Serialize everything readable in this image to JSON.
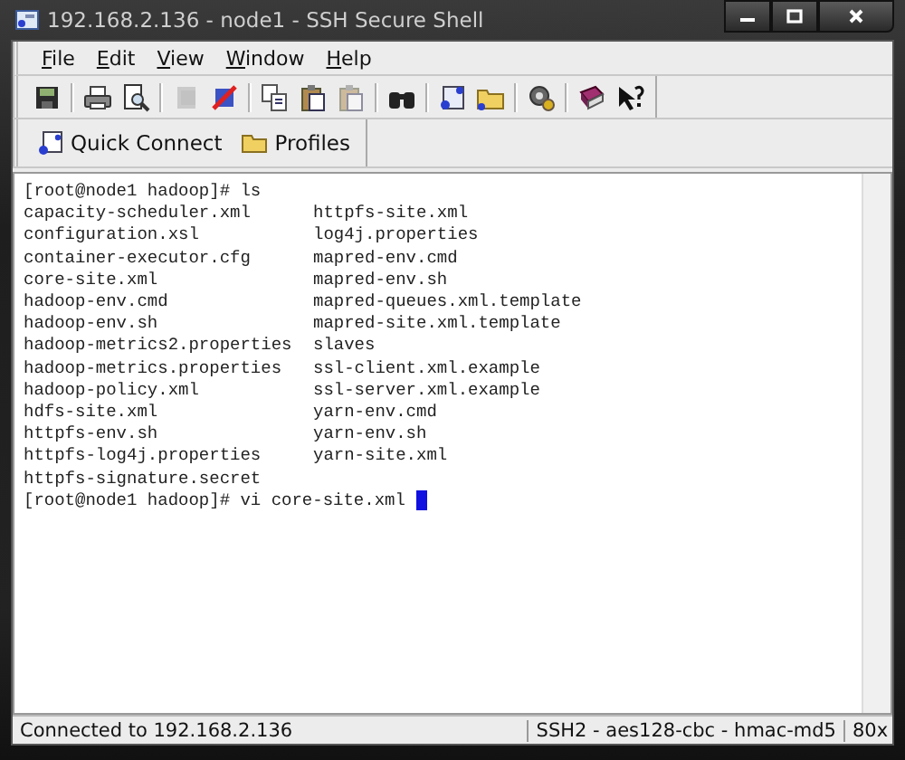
{
  "window": {
    "title": "192.168.2.136 - node1 - SSH Secure Shell"
  },
  "menu": [
    {
      "label": "File"
    },
    {
      "label": "Edit"
    },
    {
      "label": "View"
    },
    {
      "label": "Window"
    },
    {
      "label": "Help"
    }
  ],
  "quickbar": [
    {
      "label": "Quick Connect",
      "kind": "connect"
    },
    {
      "label": "Profiles",
      "kind": "folder"
    }
  ],
  "terminal": {
    "lines": [
      {
        "kind": "text",
        "text": "[root@node1 hadoop]# ls"
      },
      {
        "kind": "columns",
        "cells": [
          "capacity-scheduler.xml",
          "httpfs-site.xml"
        ]
      },
      {
        "kind": "columns",
        "cells": [
          "configuration.xsl",
          "log4j.properties"
        ]
      },
      {
        "kind": "columns",
        "cells": [
          "container-executor.cfg",
          "mapred-env.cmd"
        ]
      },
      {
        "kind": "columns",
        "cells": [
          "core-site.xml",
          "mapred-env.sh"
        ]
      },
      {
        "kind": "columns",
        "cells": [
          "hadoop-env.cmd",
          "mapred-queues.xml.template"
        ]
      },
      {
        "kind": "columns",
        "cells": [
          "hadoop-env.sh",
          "mapred-site.xml.template"
        ]
      },
      {
        "kind": "columns",
        "cells": [
          "hadoop-metrics2.properties",
          "slaves"
        ]
      },
      {
        "kind": "columns",
        "cells": [
          "hadoop-metrics.properties",
          "ssl-client.xml.example"
        ]
      },
      {
        "kind": "columns",
        "cells": [
          "hadoop-policy.xml",
          "ssl-server.xml.example"
        ]
      },
      {
        "kind": "columns",
        "cells": [
          "hdfs-site.xml",
          "yarn-env.cmd"
        ]
      },
      {
        "kind": "columns",
        "cells": [
          "httpfs-env.sh",
          "yarn-env.sh"
        ]
      },
      {
        "kind": "columns",
        "cells": [
          "httpfs-log4j.properties",
          "yarn-site.xml"
        ]
      },
      {
        "kind": "text",
        "text": "httpfs-signature.secret"
      },
      {
        "kind": "prompt",
        "text": "[root@node1 hadoop]# vi core-site.xml",
        "cursor": true
      }
    ]
  },
  "status_bar": {
    "connection": "Connected to 192.168.2.136",
    "cipher": "SSH2 - aes128-cbc - hmac-md5",
    "size": "80x"
  }
}
